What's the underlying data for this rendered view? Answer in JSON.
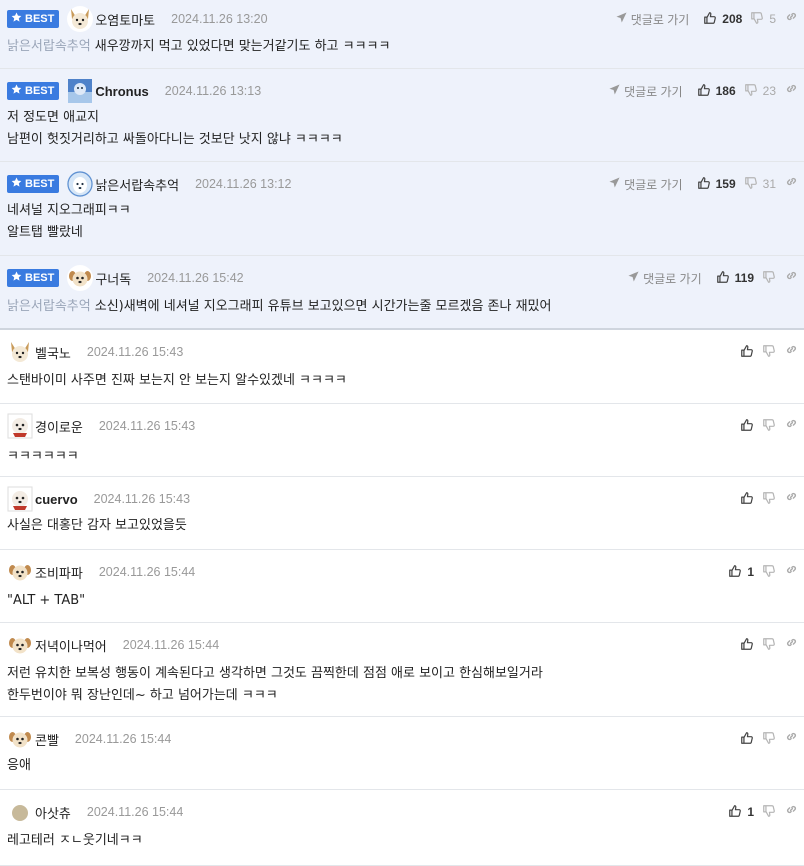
{
  "best_label": "BEST",
  "reply_label": "댓글로 가기",
  "comments": [
    {
      "best": true,
      "nick": "오염토마토",
      "date": "2024.11.26 13:20",
      "up": "208",
      "down": "5",
      "mention": "낡은서랍속추억",
      "lines": [
        "새우깡까지 먹고 있었다면 맞는거같기도 하고 ㅋㅋㅋㅋ"
      ],
      "avatar": "dog-white"
    },
    {
      "best": true,
      "nick": "Chronus",
      "date": "2024.11.26 13:13",
      "up": "186",
      "down": "23",
      "mention": "",
      "lines": [
        "저 정도면 애교지",
        "남편이 헛짓거리하고 싸돌아다니는 것보단 낫지 않냐 ㅋㅋㅋㅋ"
      ],
      "avatar": "blue-square"
    },
    {
      "best": true,
      "nick": "낡은서랍속추억",
      "date": "2024.11.26 13:12",
      "up": "159",
      "down": "31",
      "mention": "",
      "lines": [
        "네셔널 지오그래피ㅋㅋ",
        "알트탭 빨랐네"
      ],
      "avatar": "blue-dog"
    },
    {
      "best": true,
      "nick": "구너독",
      "date": "2024.11.26 15:42",
      "up": "119",
      "down": "",
      "mention": "낡은서랍속추억",
      "lines": [
        "소신)새벽에 네셔널 지오그래피 유튜브 보고있으면 시간가는줄 모르겠음 존나 재밌어"
      ],
      "avatar": "puppy"
    },
    {
      "best": false,
      "nick": "벨국노",
      "date": "2024.11.26 15:43",
      "up": "",
      "down": "",
      "mention": "",
      "lines": [
        "스탠바이미 사주면 진짜 보는지 안 보는지 알수있겠네 ㅋㅋㅋㅋ"
      ],
      "avatar": "dog-white"
    },
    {
      "best": false,
      "nick": "경이로운",
      "date": "2024.11.26 15:43",
      "up": "",
      "down": "",
      "mention": "",
      "lines": [
        "ㅋㅋㅋㅋㅋㅋ"
      ],
      "avatar": "dog-red"
    },
    {
      "best": false,
      "nick": "cuervo",
      "date": "2024.11.26 15:43",
      "up": "",
      "down": "",
      "mention": "",
      "lines": [
        "사실은 대홍단 감자 보고있었을듯"
      ],
      "avatar": "dog-red"
    },
    {
      "best": false,
      "nick": "조비파파",
      "date": "2024.11.26 15:44",
      "up": "1",
      "down": "",
      "mention": "",
      "lines": [
        "\"ALT + TAB\""
      ],
      "avatar": "puppy"
    },
    {
      "best": false,
      "nick": "저녁이나먹어",
      "date": "2024.11.26 15:44",
      "up": "",
      "down": "",
      "mention": "",
      "lines": [
        "저런 유치한 보복성 행동이 계속된다고 생각하면 그것도 끔찍한데 점점 애로 보이고 한심해보일거라",
        "한두번이야 뭐 장난인데~ 하고 넘어가는데 ㅋㅋㅋ"
      ],
      "avatar": "puppy"
    },
    {
      "best": false,
      "nick": "콘빨",
      "date": "2024.11.26 15:44",
      "up": "",
      "down": "",
      "mention": "",
      "lines": [
        "응애"
      ],
      "avatar": "puppy"
    },
    {
      "best": false,
      "nick": "아삿츄",
      "date": "2024.11.26 15:44",
      "up": "1",
      "down": "",
      "mention": "",
      "lines": [
        "레고테러 ㅈㄴ웃기네ㅋㅋ"
      ],
      "avatar": "dot"
    }
  ]
}
